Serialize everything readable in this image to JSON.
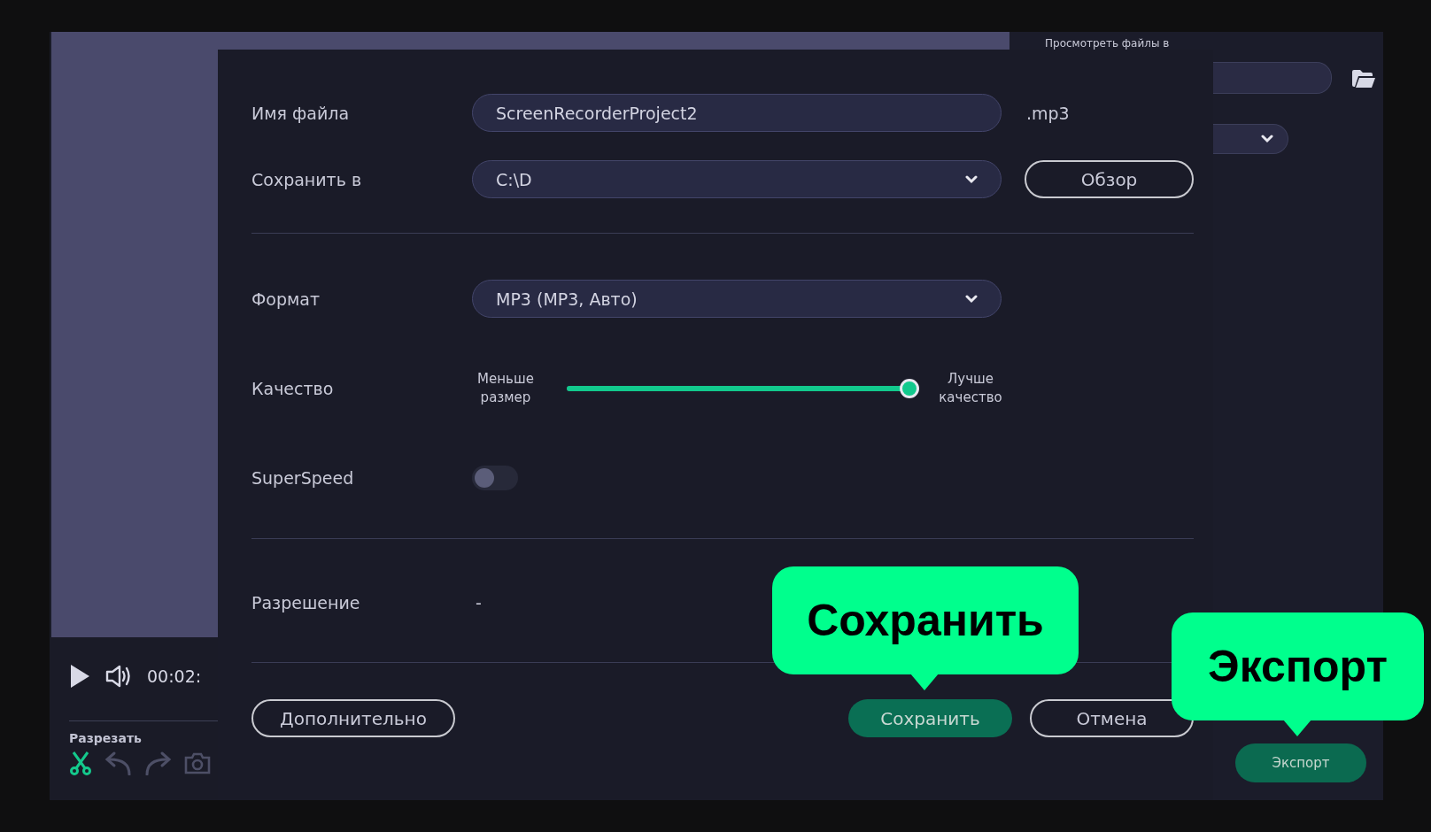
{
  "background_app": {
    "panel_heading": "Просмотреть файлы в",
    "player": {
      "time": "00:02:"
    },
    "tools": {
      "label": "Разрезать"
    },
    "export_button": "Экспорт"
  },
  "dialog": {
    "file_name": {
      "label": "Имя файла",
      "value": "ScreenRecorderProject2",
      "extension": ".mp3"
    },
    "save_to": {
      "label": "Сохранить в",
      "value": "C:\\D",
      "browse_button": "Обзор"
    },
    "format": {
      "label": "Формат",
      "value": "MP3 (MP3, Авто)"
    },
    "quality": {
      "label": "Качество",
      "min_label": "Меньше размер",
      "max_label": "Лучше качество",
      "level": 1
    },
    "superspeed": {
      "label": "SuperSpeed",
      "on": false
    },
    "resolution": {
      "label": "Разрешение",
      "value": "-"
    },
    "buttons": [
      {
        "kind": "extra",
        "label": "Дополнительно"
      },
      {
        "kind": "primary",
        "label": "Сохранить"
      },
      {
        "kind": "outline",
        "label": "Отмена"
      }
    ]
  },
  "callouts": [
    {
      "text": "Сохранить"
    },
    {
      "text": "Экспорт"
    }
  ]
}
